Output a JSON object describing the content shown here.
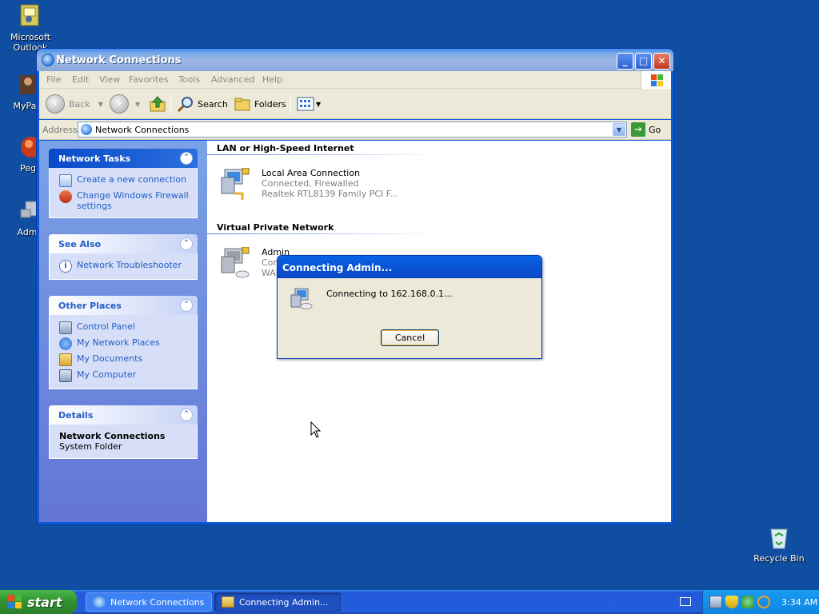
{
  "desktop": {
    "icons": [
      {
        "label": "Microsoft\nOutlook"
      },
      {
        "label": "MyPa"
      },
      {
        "label": "Peg"
      },
      {
        "label": "Adm"
      },
      {
        "label": "Recycle Bin"
      }
    ],
    "background_color": "#0f4ea0"
  },
  "window": {
    "title": "Network Connections",
    "menu": [
      "File",
      "Edit",
      "View",
      "Favorites",
      "Tools",
      "Advanced",
      "Help"
    ],
    "toolbar": {
      "back": "Back",
      "search": "Search",
      "folders": "Folders"
    },
    "address": {
      "label": "Address",
      "value": "Network Connections",
      "go": "Go"
    },
    "sidebar": {
      "network_tasks": {
        "title": "Network Tasks",
        "items": [
          "Create a new connection",
          "Change Windows Firewall settings"
        ]
      },
      "see_also": {
        "title": "See Also",
        "items": [
          "Network Troubleshooter"
        ]
      },
      "other_places": {
        "title": "Other Places",
        "items": [
          "Control Panel",
          "My Network Places",
          "My Documents",
          "My Computer"
        ]
      },
      "details": {
        "title": "Details",
        "name": "Network Connections",
        "type": "System Folder"
      }
    },
    "groups": [
      {
        "title": "LAN or High-Speed Internet",
        "connection": {
          "name": "Local Area Connection",
          "status": "Connected, Firewalled",
          "device": "Realtek RTL8139 Family PCI F..."
        }
      },
      {
        "title": "Virtual Private Network",
        "connection": {
          "name": "Admin",
          "status": "Con",
          "device": "WAN"
        }
      }
    ]
  },
  "dialog": {
    "title": "Connecting Admin...",
    "message": "Connecting to 162.168.0.1...",
    "cancel": "Cancel"
  },
  "taskbar": {
    "start": "start",
    "tasks": [
      "Network Connections",
      "Connecting Admin..."
    ],
    "clock": "3:34 AM"
  }
}
